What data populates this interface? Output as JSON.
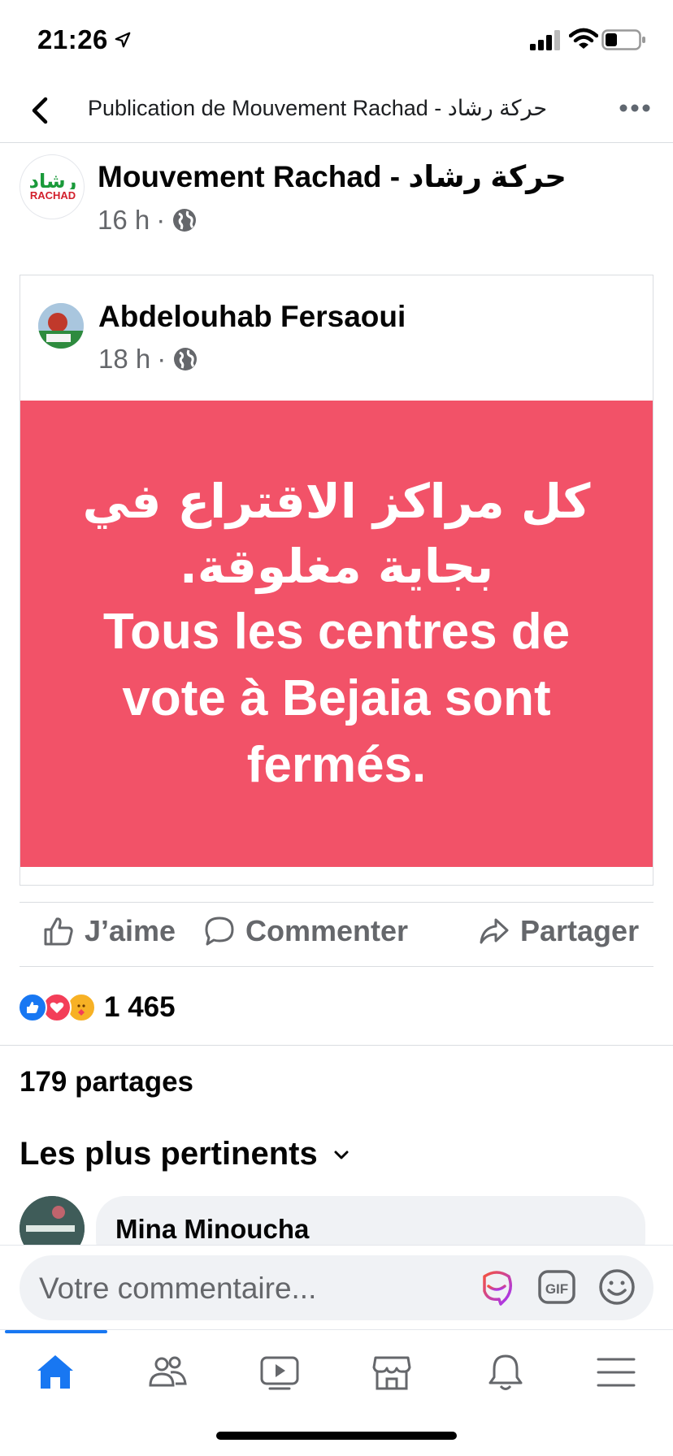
{
  "status_bar": {
    "time": "21:26"
  },
  "nav": {
    "title": "Publication de Mouvement Rachad - حركة رشاد"
  },
  "post": {
    "page_name": "Mouvement Rachad - حركة رشاد",
    "avatar_text": "رشاد",
    "avatar_sub": "RACHAD",
    "time": "16 h",
    "separator": "·"
  },
  "shared_post": {
    "author": "Abdelouhab Fersaoui",
    "time": "18 h",
    "separator": "·",
    "banner_arabic_line1": "كل مراكز الاقتراع في",
    "banner_arabic_line2": "بجاية مغلوقة.",
    "banner_french_line1": "Tous les centres de",
    "banner_french_line2": "vote à Bejaia sont",
    "banner_french_line3": "fermés.",
    "banner_color": "#f25268"
  },
  "actions": {
    "like": "J’aime",
    "comment": "Commenter",
    "share": "Partager"
  },
  "reactions": {
    "icons": [
      "like-reaction-icon",
      "love-reaction-icon",
      "care-reaction-icon"
    ],
    "count": "1 465"
  },
  "shares": {
    "label": "179 partages"
  },
  "comments": {
    "sort_label": "Les plus pertinents",
    "first_author": "Mina Minoucha"
  },
  "composer": {
    "placeholder": "Votre commentaire..."
  },
  "tabs": [
    "home-icon",
    "friends-icon",
    "watch-icon",
    "marketplace-icon",
    "notifications-icon",
    "menu-icon"
  ],
  "colors": {
    "accent": "#1877f2",
    "secondary_text": "#65676b",
    "surface": "#f0f2f5"
  }
}
